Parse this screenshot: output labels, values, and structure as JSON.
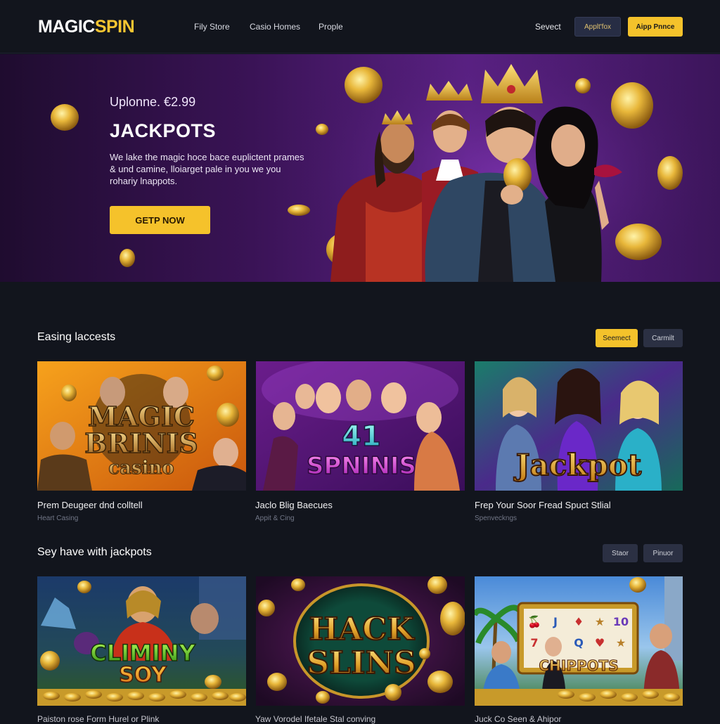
{
  "brand": {
    "part1": "MAGIC",
    "part2": "SPIN"
  },
  "nav": [
    {
      "label": "Fily Store"
    },
    {
      "label": "Casio Homes"
    },
    {
      "label": "Prople"
    }
  ],
  "header_actions": {
    "link": "Sevect",
    "secondary_button": "Applt'fox",
    "primary_button": "Aipp Pnnce"
  },
  "hero": {
    "price": "Uplonne. €2.99",
    "title": "JACKPOTS",
    "description": "We lake the magic hoce bace euplictent prames & und camine, lloiarget pale in you we you rohariy lnappots.",
    "cta": "GETP NOW"
  },
  "section1": {
    "title": "Easing laccests",
    "btn_primary": "Seemect",
    "btn_secondary": "Carmilt",
    "cards": [
      {
        "art_text_1": "MAGIC",
        "art_text_2": "BRINIS",
        "art_text_3": "casino",
        "title": "Prem Deugeer dnd colltell",
        "subtitle": "Heart Casing"
      },
      {
        "art_text_1": "41",
        "art_text_2": "SPNINIS",
        "title": "Jaclo Blig Baecues",
        "subtitle": "Appit & Cing"
      },
      {
        "art_text_1": "Jackpot",
        "title": "Frep Your Soor Fread Spuct Stlial",
        "subtitle": "Spenveckngs"
      }
    ]
  },
  "section2": {
    "title": "Sey have with jackpots",
    "btn_primary": "Staor",
    "btn_secondary": "Pinuor",
    "cards": [
      {
        "art_text_1": "CLIMINY",
        "art_text_2": "SOY",
        "title": "Paiston rose Form Hurel or Plink"
      },
      {
        "art_text_1": "HACK",
        "art_text_2": "SLINS",
        "title": "Yaw Vorodel Ifetale Stal conving"
      },
      {
        "art_text_1": "CHIPPOTS",
        "title": "Juck Co Seen & Ahipor"
      }
    ]
  },
  "colors": {
    "accent": "#f4c22b",
    "background": "#12151d",
    "hero_purple": "#5a2184"
  }
}
